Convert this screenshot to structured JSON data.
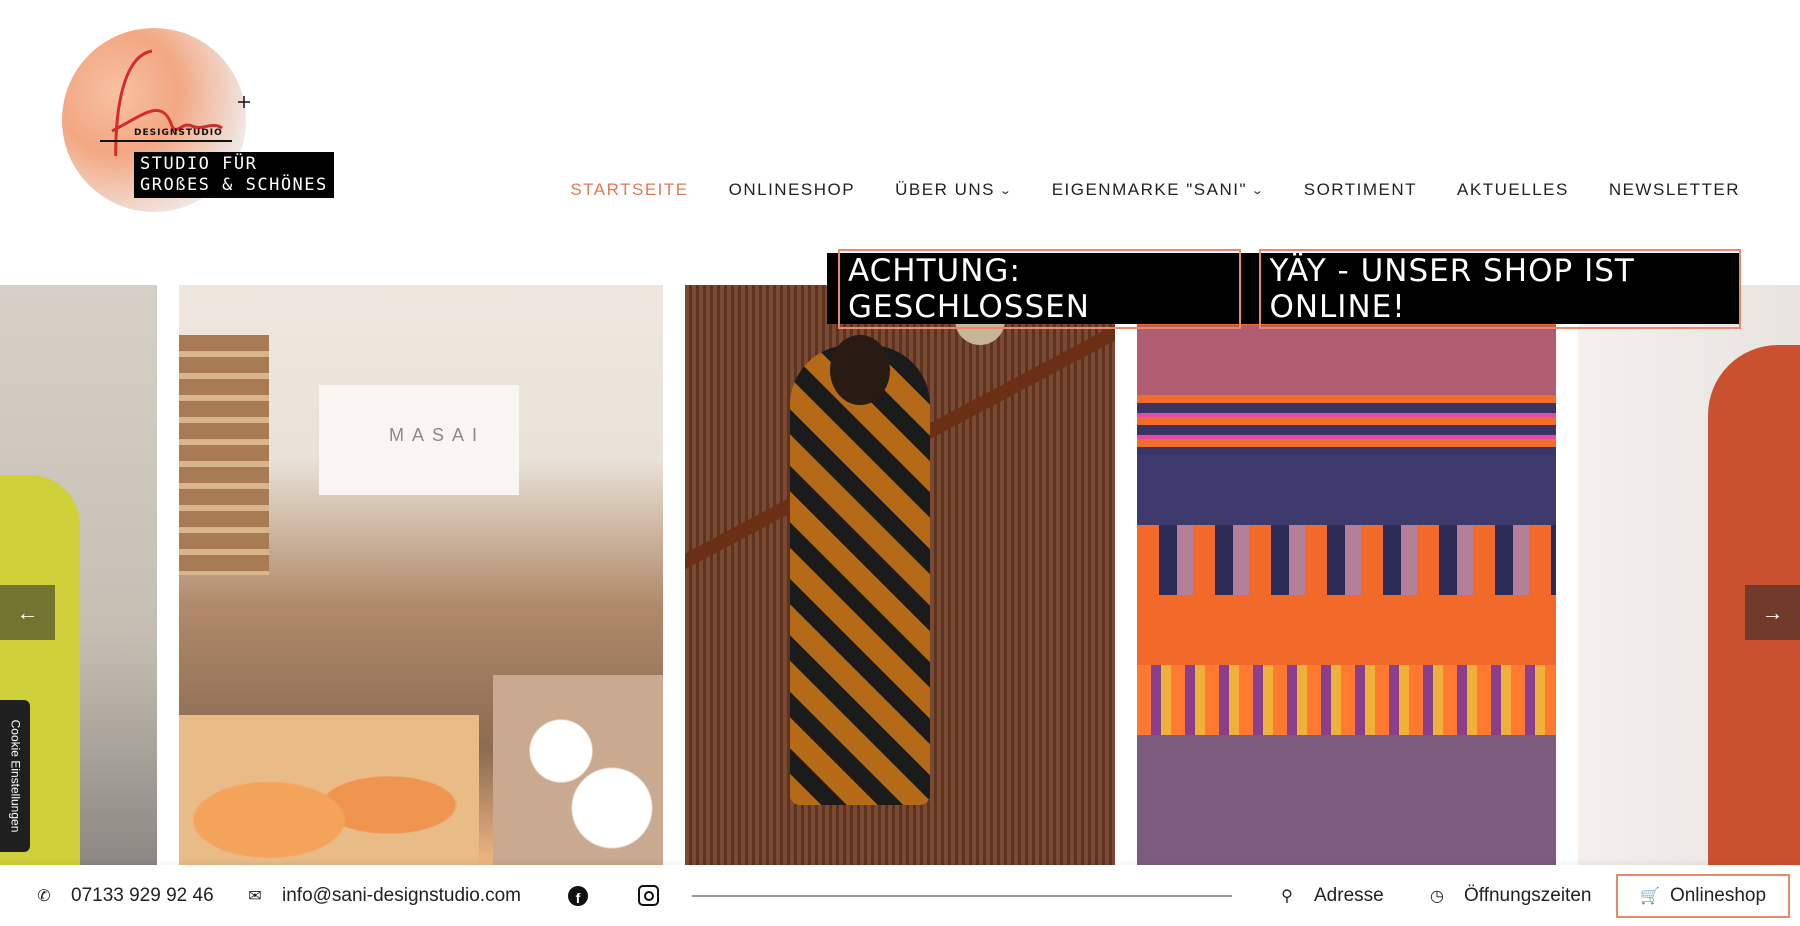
{
  "logo": {
    "sub": "DESIGNSTUDIO",
    "line1": "STUDIO FÜR",
    "line2": "GROßES & SCHÖNES"
  },
  "nav": {
    "items": [
      "STARTSEITE",
      "ONLINESHOP",
      "ÜBER UNS",
      "EIGENMARKE \"SANI\"",
      "SORTIMENT",
      "AKTUELLES",
      "NEWSLETTER"
    ],
    "active": "STARTSEITE",
    "active_color": "#e07a55"
  },
  "banner": {
    "left": "ACHTUNG: GESCHLOSSEN",
    "right": "YÄY - UNSER SHOP IST ONLINE!",
    "border_color": "#e58a6a"
  },
  "gallery": {
    "store_sign": "MASAI",
    "prev_icon": "←",
    "next_icon": "→"
  },
  "cookie": {
    "label": "Cookie Einstellungen"
  },
  "footer": {
    "phone": "07133 929 92 46",
    "email": "info@sani-designstudio.com",
    "address": "Adresse",
    "hours": "Öffnungszeiten",
    "shop": "Onlineshop"
  }
}
